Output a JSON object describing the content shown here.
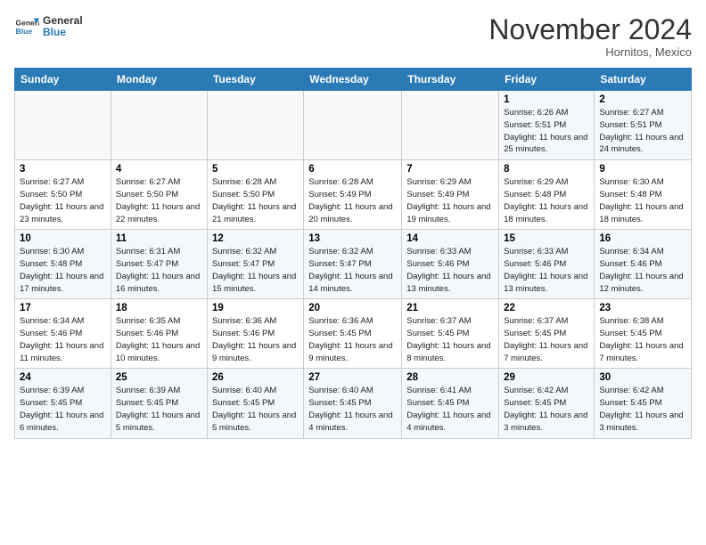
{
  "header": {
    "logo_line1": "General",
    "logo_line2": "Blue",
    "month": "November 2024",
    "location": "Hornitos, Mexico"
  },
  "days_of_week": [
    "Sunday",
    "Monday",
    "Tuesday",
    "Wednesday",
    "Thursday",
    "Friday",
    "Saturday"
  ],
  "weeks": [
    [
      {
        "day": "",
        "info": ""
      },
      {
        "day": "",
        "info": ""
      },
      {
        "day": "",
        "info": ""
      },
      {
        "day": "",
        "info": ""
      },
      {
        "day": "",
        "info": ""
      },
      {
        "day": "1",
        "info": "Sunrise: 6:26 AM\nSunset: 5:51 PM\nDaylight: 11 hours and 25 minutes."
      },
      {
        "day": "2",
        "info": "Sunrise: 6:27 AM\nSunset: 5:51 PM\nDaylight: 11 hours and 24 minutes."
      }
    ],
    [
      {
        "day": "3",
        "info": "Sunrise: 6:27 AM\nSunset: 5:50 PM\nDaylight: 11 hours and 23 minutes."
      },
      {
        "day": "4",
        "info": "Sunrise: 6:27 AM\nSunset: 5:50 PM\nDaylight: 11 hours and 22 minutes."
      },
      {
        "day": "5",
        "info": "Sunrise: 6:28 AM\nSunset: 5:50 PM\nDaylight: 11 hours and 21 minutes."
      },
      {
        "day": "6",
        "info": "Sunrise: 6:28 AM\nSunset: 5:49 PM\nDaylight: 11 hours and 20 minutes."
      },
      {
        "day": "7",
        "info": "Sunrise: 6:29 AM\nSunset: 5:49 PM\nDaylight: 11 hours and 19 minutes."
      },
      {
        "day": "8",
        "info": "Sunrise: 6:29 AM\nSunset: 5:48 PM\nDaylight: 11 hours and 18 minutes."
      },
      {
        "day": "9",
        "info": "Sunrise: 6:30 AM\nSunset: 5:48 PM\nDaylight: 11 hours and 18 minutes."
      }
    ],
    [
      {
        "day": "10",
        "info": "Sunrise: 6:30 AM\nSunset: 5:48 PM\nDaylight: 11 hours and 17 minutes."
      },
      {
        "day": "11",
        "info": "Sunrise: 6:31 AM\nSunset: 5:47 PM\nDaylight: 11 hours and 16 minutes."
      },
      {
        "day": "12",
        "info": "Sunrise: 6:32 AM\nSunset: 5:47 PM\nDaylight: 11 hours and 15 minutes."
      },
      {
        "day": "13",
        "info": "Sunrise: 6:32 AM\nSunset: 5:47 PM\nDaylight: 11 hours and 14 minutes."
      },
      {
        "day": "14",
        "info": "Sunrise: 6:33 AM\nSunset: 5:46 PM\nDaylight: 11 hours and 13 minutes."
      },
      {
        "day": "15",
        "info": "Sunrise: 6:33 AM\nSunset: 5:46 PM\nDaylight: 11 hours and 13 minutes."
      },
      {
        "day": "16",
        "info": "Sunrise: 6:34 AM\nSunset: 5:46 PM\nDaylight: 11 hours and 12 minutes."
      }
    ],
    [
      {
        "day": "17",
        "info": "Sunrise: 6:34 AM\nSunset: 5:46 PM\nDaylight: 11 hours and 11 minutes."
      },
      {
        "day": "18",
        "info": "Sunrise: 6:35 AM\nSunset: 5:46 PM\nDaylight: 11 hours and 10 minutes."
      },
      {
        "day": "19",
        "info": "Sunrise: 6:36 AM\nSunset: 5:46 PM\nDaylight: 11 hours and 9 minutes."
      },
      {
        "day": "20",
        "info": "Sunrise: 6:36 AM\nSunset: 5:45 PM\nDaylight: 11 hours and 9 minutes."
      },
      {
        "day": "21",
        "info": "Sunrise: 6:37 AM\nSunset: 5:45 PM\nDaylight: 11 hours and 8 minutes."
      },
      {
        "day": "22",
        "info": "Sunrise: 6:37 AM\nSunset: 5:45 PM\nDaylight: 11 hours and 7 minutes."
      },
      {
        "day": "23",
        "info": "Sunrise: 6:38 AM\nSunset: 5:45 PM\nDaylight: 11 hours and 7 minutes."
      }
    ],
    [
      {
        "day": "24",
        "info": "Sunrise: 6:39 AM\nSunset: 5:45 PM\nDaylight: 11 hours and 6 minutes."
      },
      {
        "day": "25",
        "info": "Sunrise: 6:39 AM\nSunset: 5:45 PM\nDaylight: 11 hours and 5 minutes."
      },
      {
        "day": "26",
        "info": "Sunrise: 6:40 AM\nSunset: 5:45 PM\nDaylight: 11 hours and 5 minutes."
      },
      {
        "day": "27",
        "info": "Sunrise: 6:40 AM\nSunset: 5:45 PM\nDaylight: 11 hours and 4 minutes."
      },
      {
        "day": "28",
        "info": "Sunrise: 6:41 AM\nSunset: 5:45 PM\nDaylight: 11 hours and 4 minutes."
      },
      {
        "day": "29",
        "info": "Sunrise: 6:42 AM\nSunset: 5:45 PM\nDaylight: 11 hours and 3 minutes."
      },
      {
        "day": "30",
        "info": "Sunrise: 6:42 AM\nSunset: 5:45 PM\nDaylight: 11 hours and 3 minutes."
      }
    ]
  ]
}
